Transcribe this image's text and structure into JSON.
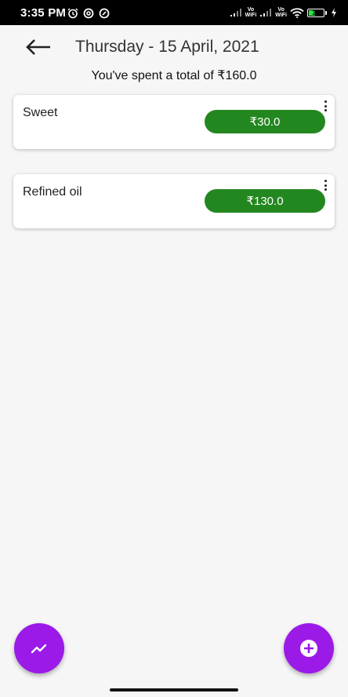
{
  "status_bar": {
    "time": "3:35 PM",
    "left_icons": [
      "alarm-icon",
      "data-saver-icon",
      "notification-icon"
    ],
    "right_icons": [
      "signal-icon",
      "vowifi-icon",
      "signal-icon",
      "vowifi-icon",
      "wifi-icon",
      "battery-icon",
      "charging-icon"
    ],
    "vowifi_label_top": "Vo",
    "vowifi_label_bottom": "WiFi",
    "battery_level": "30"
  },
  "header": {
    "back_icon": "arrow-left-icon",
    "title": "Thursday - 15 April, 2021"
  },
  "summary": {
    "text": "You've spent a total of ₹160.0"
  },
  "expenses": [
    {
      "label": "Sweet",
      "amount": "₹30.0",
      "menu_icon": "more-vert-icon"
    },
    {
      "label": "Refined oil",
      "amount": "₹130.0",
      "menu_icon": "more-vert-icon"
    }
  ],
  "fabs": {
    "left_icon": "trending-up-icon",
    "right_icon": "add-circle-icon"
  },
  "colors": {
    "accent": "#9b1ae8",
    "amount_pill": "#23871f",
    "background": "#f6f6f6",
    "status_bar": "#000000"
  }
}
